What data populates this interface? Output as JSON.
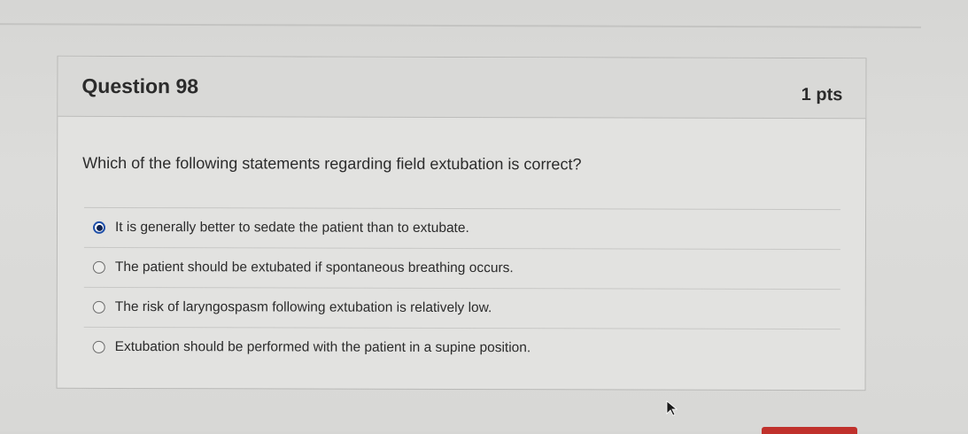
{
  "question": {
    "title": "Question 98",
    "points": "1 pts",
    "text": "Which of the following statements regarding ﬁeld extubation is correct?"
  },
  "answers": [
    {
      "label": "It is generally better to sedate the patient than to extubate.",
      "selected": true
    },
    {
      "label": "The patient should be extubated if spontaneous breathing occurs.",
      "selected": false
    },
    {
      "label": "The risk of laryngospasm following extubation is relatively low.",
      "selected": false
    },
    {
      "label": "Extubation should be performed with the patient in a supine position.",
      "selected": false
    }
  ],
  "colors": {
    "background": "#d9d9d7",
    "card": "#e2e2e0",
    "text": "#2b2b2b",
    "radio_selected": "#1f4fa8",
    "button_accent": "#c0312c"
  },
  "icons": {
    "cursor": "mouse-pointer-icon"
  }
}
